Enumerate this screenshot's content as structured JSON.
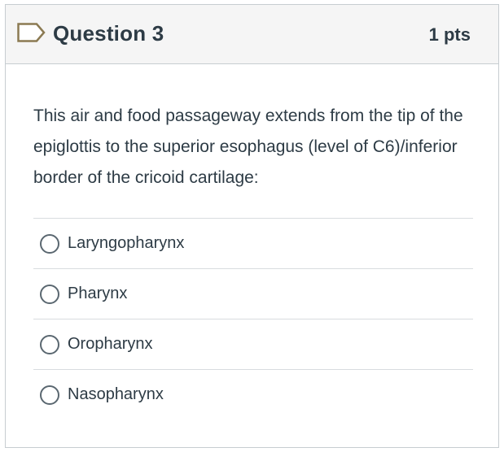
{
  "header": {
    "title": "Question 3",
    "points": "1 pts",
    "flag_icon": "bookmark-flag-icon"
  },
  "question": {
    "text": "This air and food passageway extends from the tip of the epiglottis to the superior esophagus (level of C6)/inferior border of the cricoid cartilage:"
  },
  "answers": [
    {
      "label": "Laryngopharynx",
      "selected": false
    },
    {
      "label": "Pharynx",
      "selected": false
    },
    {
      "label": "Oropharynx",
      "selected": false
    },
    {
      "label": "Nasopharynx",
      "selected": false
    }
  ],
  "colors": {
    "header_bg": "#f5f5f5",
    "border": "#c7cdd1",
    "text": "#2d3b45",
    "flag_outline": "#8b7a52"
  }
}
